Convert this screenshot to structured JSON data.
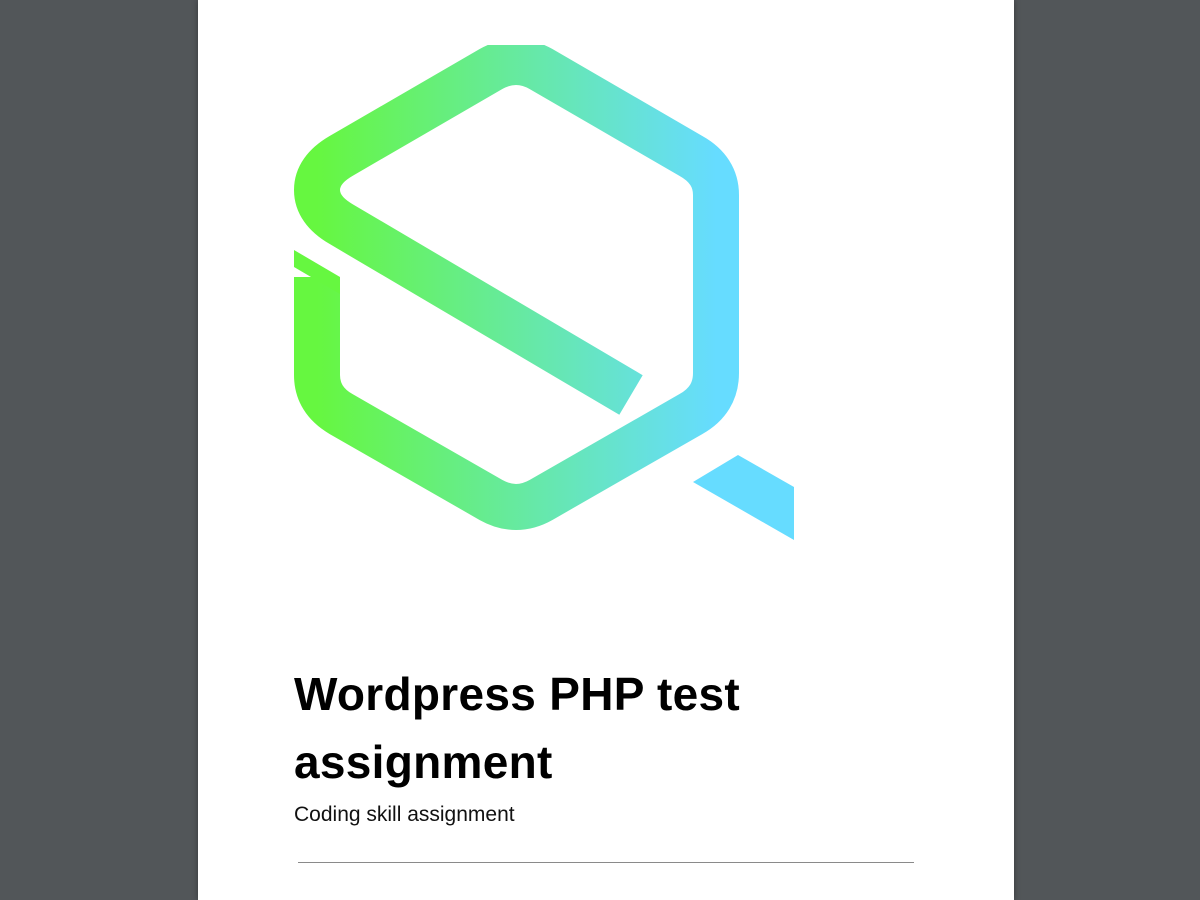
{
  "document": {
    "title": "Wordpress PHP test assignment",
    "subtitle": "Coding skill assignment"
  },
  "logo": {
    "icon": "hexagon-q-logo",
    "gradient_start": "#66f740",
    "gradient_end": "#66dcff"
  },
  "viewer": {
    "background": "#525659",
    "page_background": "#ffffff"
  }
}
